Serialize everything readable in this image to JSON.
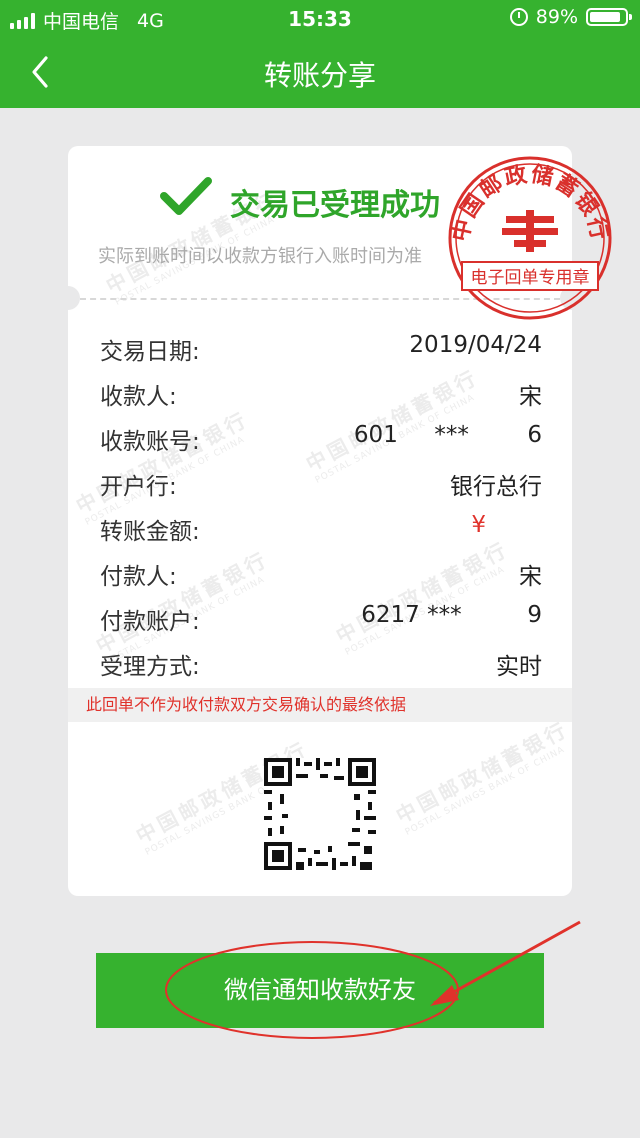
{
  "status_bar": {
    "carrier": "中国电信",
    "network": "4G",
    "time": "15:33",
    "battery": "89%",
    "battery_level": 0.89
  },
  "nav": {
    "title": "转账分享",
    "back_icon": "chevron-left-icon"
  },
  "receipt": {
    "status_title": "交易已受理成功",
    "status_icon": "checkmark-icon",
    "notice": "实际到账时间以收款方银行入账时间为准",
    "fields": [
      {
        "label": "交易日期:",
        "value": "2019/04/24"
      },
      {
        "label": "收款人:",
        "value": "宋"
      },
      {
        "label": "收款账号:",
        "value": "601     ***        6"
      },
      {
        "label": "开户行:",
        "value": "银行总行"
      },
      {
        "label": "转账金额:",
        "value": "¥"
      },
      {
        "label": "付款人:",
        "value": "宋"
      },
      {
        "label": "付款账户:",
        "value": "6217 ***         9"
      },
      {
        "label": "受理方式:",
        "value": "实时"
      }
    ],
    "disclaimer": "此回单不作为收付款双方交易确认的最终依据",
    "watermark_text": "中国邮政储蓄银行",
    "watermark_sub": "POSTAL SAVINGS BANK OF CHINA",
    "stamp": {
      "top_text": "中国邮政储蓄银行",
      "bottom_text": "电子回单专用章",
      "color": "#d9302c"
    },
    "qr_icon": "qr-code-icon"
  },
  "action_button": {
    "label": "微信通知收款好友"
  },
  "colors": {
    "brand_green": "#36b22f",
    "alert_red": "#e0322b",
    "background": "#e9e9ea"
  }
}
